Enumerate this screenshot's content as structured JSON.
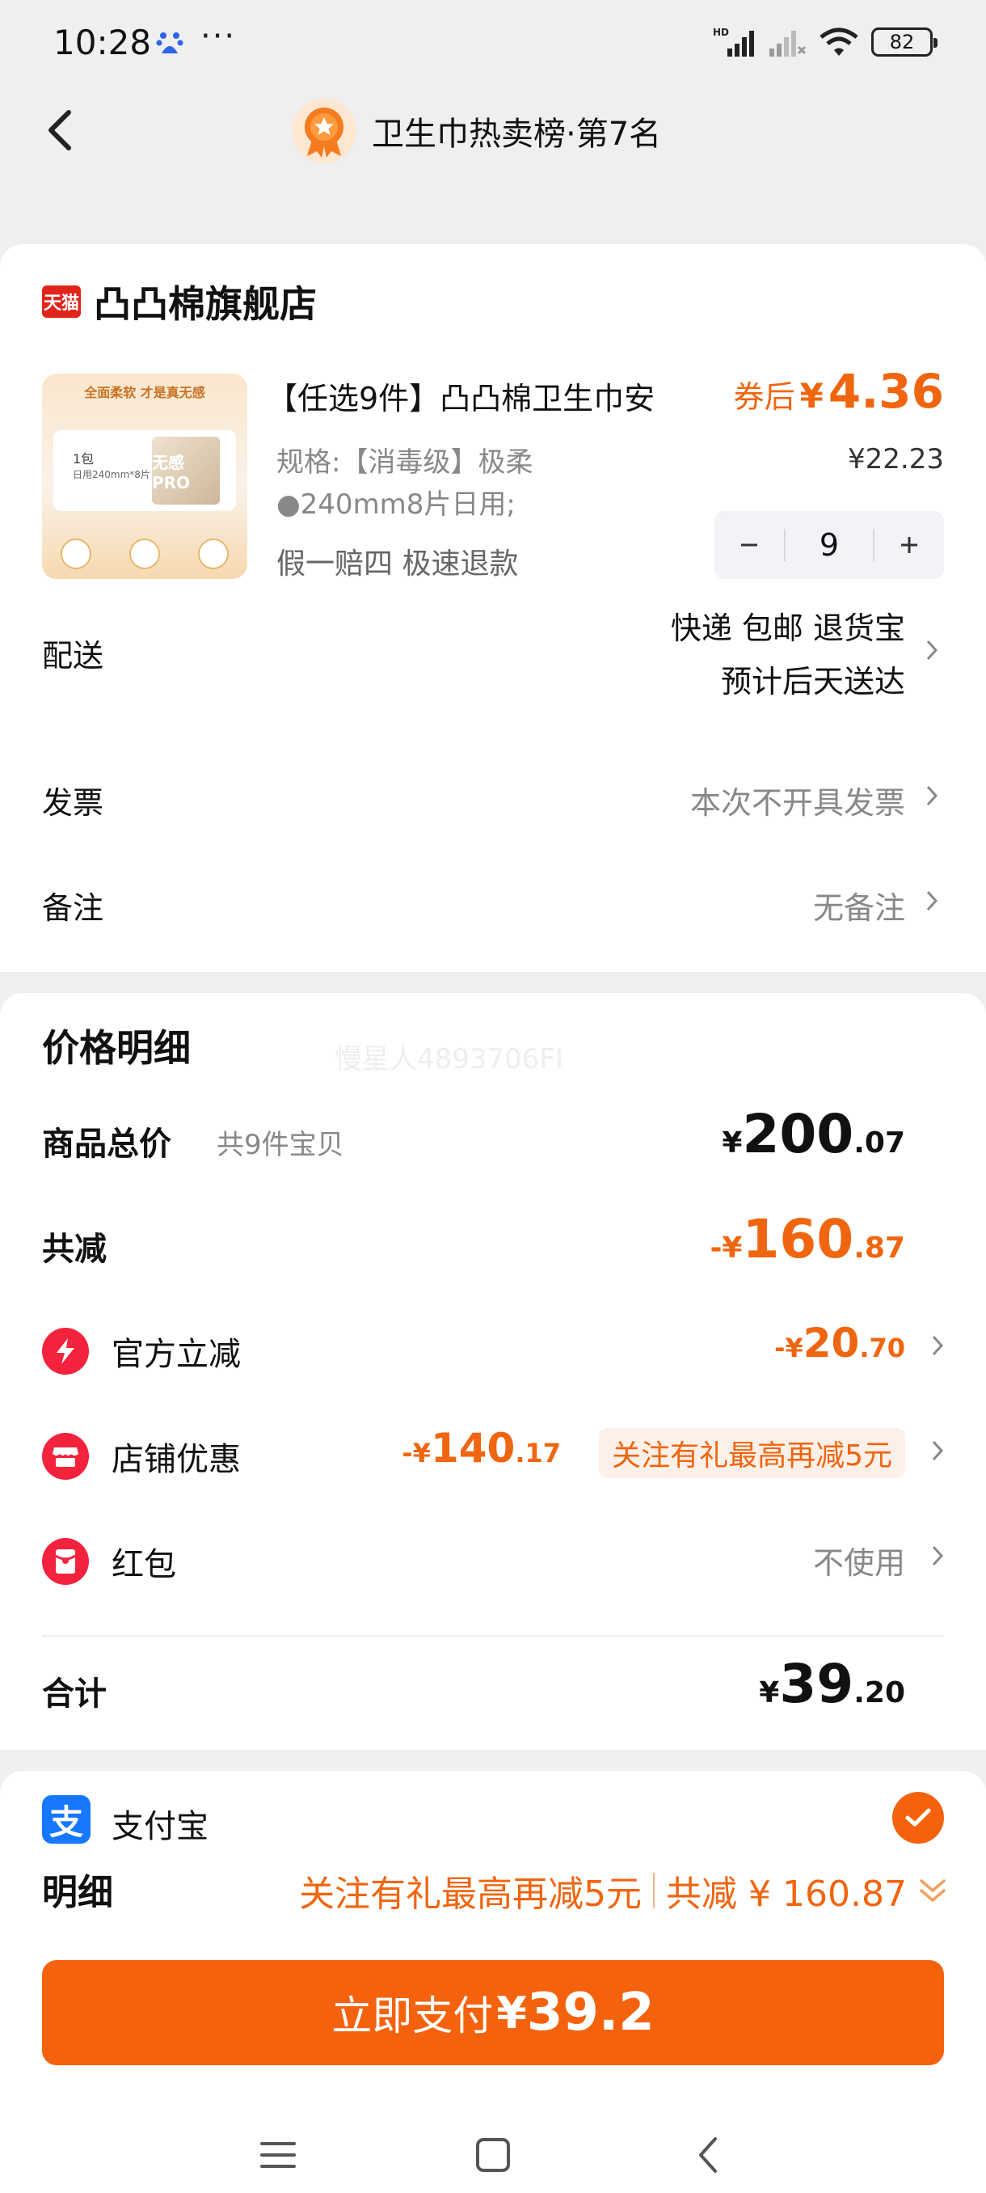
{
  "status": {
    "time": "10:28",
    "dots": "···",
    "network": "HD",
    "battery": "82"
  },
  "header": {
    "title": "卫生巾热卖榜·第7名"
  },
  "store": {
    "badge": "天猫",
    "name": "凸凸棉旗舰店",
    "product": {
      "image_text": {
        "tagline": "全面柔软  才是真无感",
        "line1": "1包",
        "line2": "日用240mm*8片",
        "box": "无感PRO"
      },
      "title": "【任选9件】凸凸棉卫生巾安",
      "spec_line1": "规格:【消毒级】极柔",
      "spec_line2": "●240mm8片日用;",
      "tags": "假一赔四  极速退款",
      "coupon_label": "券后",
      "coupon_currency": "¥",
      "coupon_price": "4.36",
      "orig_price": "¥22.23",
      "quantity": "9"
    }
  },
  "order": {
    "delivery_label": "配送",
    "delivery_line1": "快递 包邮 退货宝",
    "delivery_line2": "预计后天送达",
    "invoice_label": "发票",
    "invoice_value": "本次不开具发票",
    "note_label": "备注",
    "note_value": "无备注"
  },
  "price": {
    "title": "价格明细",
    "watermark": "慢星人4893706FI",
    "total_label": "商品总价",
    "total_sub": "共9件宝贝",
    "total_c": "¥",
    "total_i": "200",
    "total_d": ".07",
    "reduce_label": "共减",
    "reduce_c": "-¥",
    "reduce_i": "160",
    "reduce_d": ".87",
    "official_label": "官方立减",
    "official_c": "-¥",
    "official_i": "20",
    "official_d": ".70",
    "shop_label": "店铺优惠",
    "shop_c": "-¥",
    "shop_i": "140",
    "shop_d": ".17",
    "shop_badge": "关注有礼最高再减5元",
    "hongbao_label": "红包",
    "hongbao_value": "不使用",
    "sum_label": "合计",
    "sum_c": "¥",
    "sum_i": "39",
    "sum_d": ".20"
  },
  "payment": {
    "method": "支付宝"
  },
  "bottom": {
    "detail_label": "明细",
    "promo": "关注有礼最高再减5元",
    "saving": "共减 ¥ 160.87",
    "pay_text": "立即支付",
    "pay_currency": "¥",
    "pay_amount": "39.2"
  },
  "colors": {
    "accent": "#f5620d",
    "price_orange": "#f0650f",
    "red_icon": "#f4233d",
    "alipay": "#1677ff"
  }
}
